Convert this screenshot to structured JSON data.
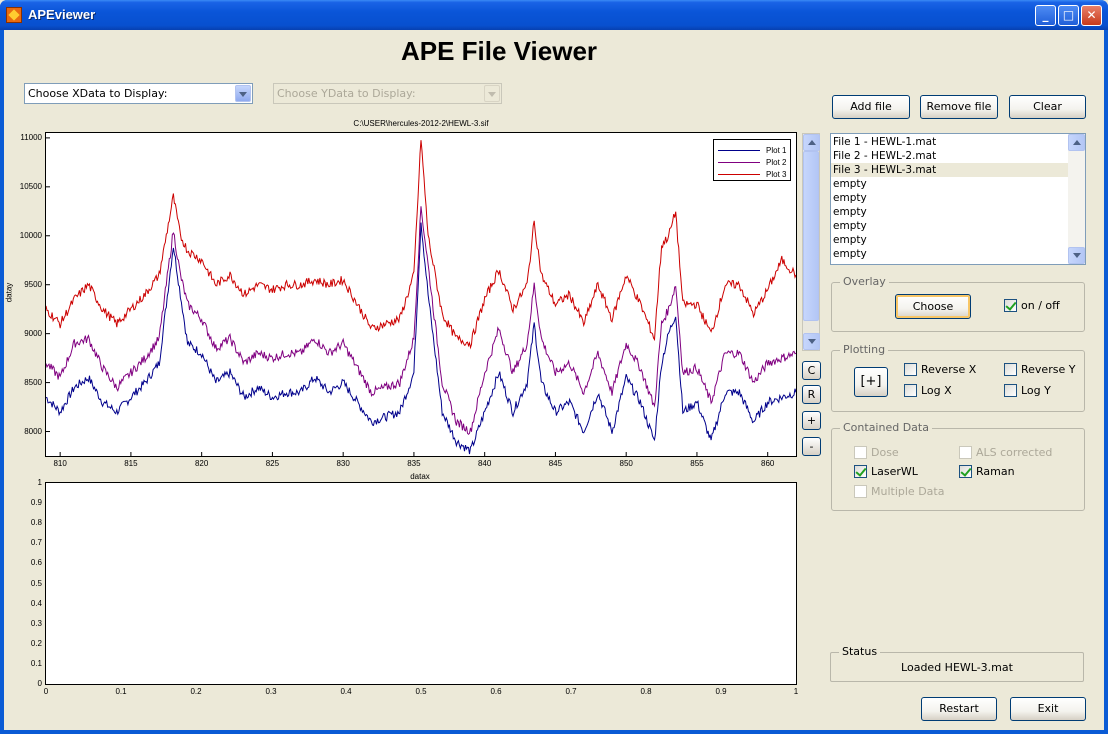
{
  "window": {
    "title": "APEviewer",
    "minimize": "_",
    "maximize": "□",
    "close": "✕"
  },
  "app_title": "APE File Viewer",
  "xdata_select": {
    "value": "Choose XData to Display:"
  },
  "ydata_select": {
    "value": "Choose YData to Display:"
  },
  "buttons": {
    "add_file": "Add file",
    "remove_file": "Remove file",
    "clear": "Clear",
    "restart": "Restart",
    "exit": "Exit"
  },
  "slider_buttons": {
    "c": "C",
    "r": "R",
    "plus": "+",
    "minus": "-"
  },
  "file_list": [
    "File 1 - HEWL-1.mat",
    "File 2 - HEWL-2.mat",
    "File 3 - HEWL-3.mat",
    "empty",
    "empty",
    "empty",
    "empty",
    "empty",
    "empty"
  ],
  "file_list_selected": 2,
  "overlay": {
    "label": "Overlay",
    "choose": "Choose",
    "on_off": "on / off",
    "on_off_checked": true
  },
  "plotting": {
    "label": "Plotting",
    "zoom": "[+]",
    "reverse_x": "Reverse X",
    "reverse_y": "Reverse Y",
    "log_x": "Log X",
    "log_y": "Log Y"
  },
  "contained_data": {
    "label": "Contained Data",
    "dose": "Dose",
    "als_corrected": "ALS corrected",
    "laser_wl": "LaserWL",
    "raman": "Raman",
    "multiple_data": "Multiple Data"
  },
  "status": {
    "label": "Status",
    "text": "Loaded HEWL-3.mat"
  },
  "colors": {
    "plot1": "#00008B",
    "plot2": "#800080",
    "plot3": "#CC0000",
    "accent": "#0A55D8"
  },
  "chart_data": [
    {
      "type": "line",
      "title": "C:\\USER\\hercules-2012-2\\HEWL-3.sif",
      "xlabel": "datax",
      "ylabel": "datay",
      "xlim": [
        809,
        862
      ],
      "ylim": [
        7750,
        11050
      ],
      "xticks": [
        810,
        815,
        820,
        825,
        830,
        835,
        840,
        845,
        850,
        855,
        860
      ],
      "yticks": [
        8000,
        8500,
        9000,
        9500,
        10000,
        10500,
        11000
      ],
      "legend": "top-right",
      "series": [
        {
          "name": "Plot 1",
          "color": "#00008B",
          "x": [
            809,
            810,
            811,
            812,
            813,
            814,
            815,
            816,
            817,
            817.5,
            818,
            818.5,
            819,
            820,
            821,
            822,
            823,
            824,
            825,
            826,
            827,
            828,
            829,
            830,
            831,
            832,
            833,
            834,
            835,
            835.5,
            836,
            837,
            838,
            839,
            840,
            841,
            842,
            843,
            843.5,
            844,
            845,
            846,
            847,
            848,
            849,
            850,
            851,
            852,
            852.5,
            853,
            853.5,
            854,
            855,
            856,
            857,
            858,
            859,
            860,
            861,
            862
          ],
          "y": [
            8350,
            8200,
            8450,
            8550,
            8300,
            8200,
            8350,
            8500,
            8700,
            9300,
            9900,
            9400,
            8900,
            8800,
            8500,
            8600,
            8350,
            8450,
            8350,
            8400,
            8400,
            8550,
            8400,
            8500,
            8300,
            8100,
            8150,
            8200,
            8600,
            10150,
            9400,
            8200,
            7900,
            7800,
            8200,
            8600,
            8200,
            8500,
            9100,
            8500,
            8200,
            8300,
            8000,
            8400,
            8000,
            8550,
            8300,
            7900,
            8700,
            9000,
            9200,
            8200,
            8300,
            7900,
            8400,
            8400,
            8100,
            8300,
            8350,
            8400
          ]
        },
        {
          "name": "Plot 2",
          "color": "#800080",
          "x": [
            809,
            810,
            811,
            812,
            813,
            814,
            815,
            816,
            817,
            817.5,
            818,
            818.5,
            819,
            820,
            821,
            822,
            823,
            824,
            825,
            826,
            827,
            828,
            829,
            830,
            831,
            832,
            833,
            834,
            835,
            835.5,
            836,
            837,
            838,
            839,
            840,
            841,
            842,
            843,
            843.5,
            844,
            845,
            846,
            847,
            848,
            849,
            850,
            851,
            852,
            852.5,
            853,
            853.5,
            854,
            855,
            856,
            857,
            858,
            859,
            860,
            861,
            862
          ],
          "y": [
            8700,
            8550,
            8900,
            8950,
            8650,
            8450,
            8600,
            8750,
            8950,
            9500,
            10050,
            9600,
            9300,
            9150,
            8850,
            8950,
            8700,
            8800,
            8750,
            8800,
            8800,
            8950,
            8800,
            8900,
            8650,
            8400,
            8450,
            8500,
            8950,
            10300,
            9700,
            8500,
            8100,
            8000,
            8600,
            9050,
            8600,
            8900,
            9500,
            8950,
            8600,
            8700,
            8400,
            8800,
            8400,
            8900,
            8650,
            8250,
            9100,
            9250,
            9500,
            8600,
            8650,
            8300,
            8800,
            8800,
            8500,
            8700,
            8750,
            8800
          ]
        },
        {
          "name": "Plot 3",
          "color": "#CC0000",
          "x": [
            809,
            810,
            811,
            812,
            813,
            814,
            815,
            816,
            817,
            817.5,
            818,
            818.5,
            819,
            820,
            821,
            822,
            823,
            824,
            825,
            826,
            827,
            828,
            829,
            830,
            831,
            832,
            833,
            834,
            835,
            835.5,
            836,
            837,
            838,
            839,
            840,
            841,
            842,
            843,
            843.5,
            844,
            845,
            846,
            847,
            848,
            849,
            850,
            851,
            852,
            852.5,
            853,
            853.5,
            854,
            855,
            856,
            857,
            858,
            859,
            860,
            861,
            862
          ],
          "y": [
            9250,
            9100,
            9350,
            9500,
            9250,
            9100,
            9250,
            9400,
            9600,
            10000,
            10400,
            10000,
            9850,
            9750,
            9500,
            9600,
            9400,
            9500,
            9450,
            9500,
            9500,
            9550,
            9500,
            9550,
            9300,
            9050,
            9100,
            9150,
            9600,
            11000,
            10000,
            9200,
            8950,
            8900,
            9350,
            9650,
            9250,
            9500,
            10150,
            9600,
            9300,
            9400,
            9100,
            9500,
            9150,
            9600,
            9300,
            8950,
            9900,
            10000,
            10250,
            9300,
            9300,
            9000,
            9500,
            9500,
            9200,
            9450,
            9750,
            9600
          ]
        }
      ]
    },
    {
      "type": "line",
      "title": "",
      "xlim": [
        0,
        1
      ],
      "ylim": [
        0,
        1
      ],
      "xticks": [
        "0",
        "0.1",
        "0.2",
        "0.3",
        "0.4",
        "0.5",
        "0.6",
        "0.7",
        "0.8",
        "0.9",
        "1"
      ],
      "yticks": [
        "0",
        "0.1",
        "0.2",
        "0.3",
        "0.4",
        "0.5",
        "0.6",
        "0.7",
        "0.8",
        "0.9",
        "1"
      ],
      "series": []
    }
  ]
}
